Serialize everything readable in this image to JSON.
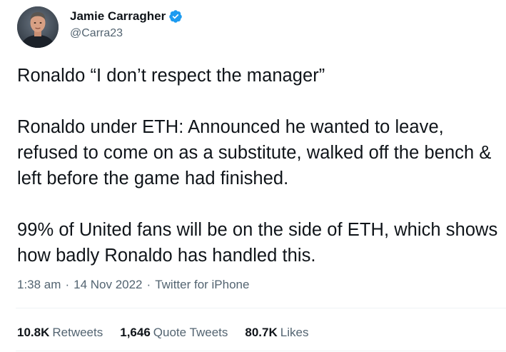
{
  "author": {
    "display_name": "Jamie Carragher",
    "handle": "@Carra23",
    "verified_badge_icon": "verified-badge-icon",
    "avatar_icon": "user-avatar-photo"
  },
  "tweet": {
    "text": "Ronaldo “I don’t respect the manager”\n\nRonaldo under ETH: Announced he wanted to leave, refused to come on as a substitute, walked off the bench & left before the game had finished.\n\n99% of United fans will be on the side of ETH, which shows how badly Ronaldo has handled this.",
    "time": "1:38 am",
    "date": "14 Nov 2022",
    "source": "Twitter for iPhone",
    "separator": "·"
  },
  "stats": {
    "retweets_count": "10.8K",
    "retweets_label": "Retweets",
    "quotes_count": "1,646",
    "quotes_label": "Quote Tweets",
    "likes_count": "80.7K",
    "likes_label": "Likes"
  },
  "colors": {
    "primary_text": "#0f1419",
    "secondary_text": "#536471",
    "verified_blue": "#1d9bf0",
    "divider": "#eff3f4"
  }
}
